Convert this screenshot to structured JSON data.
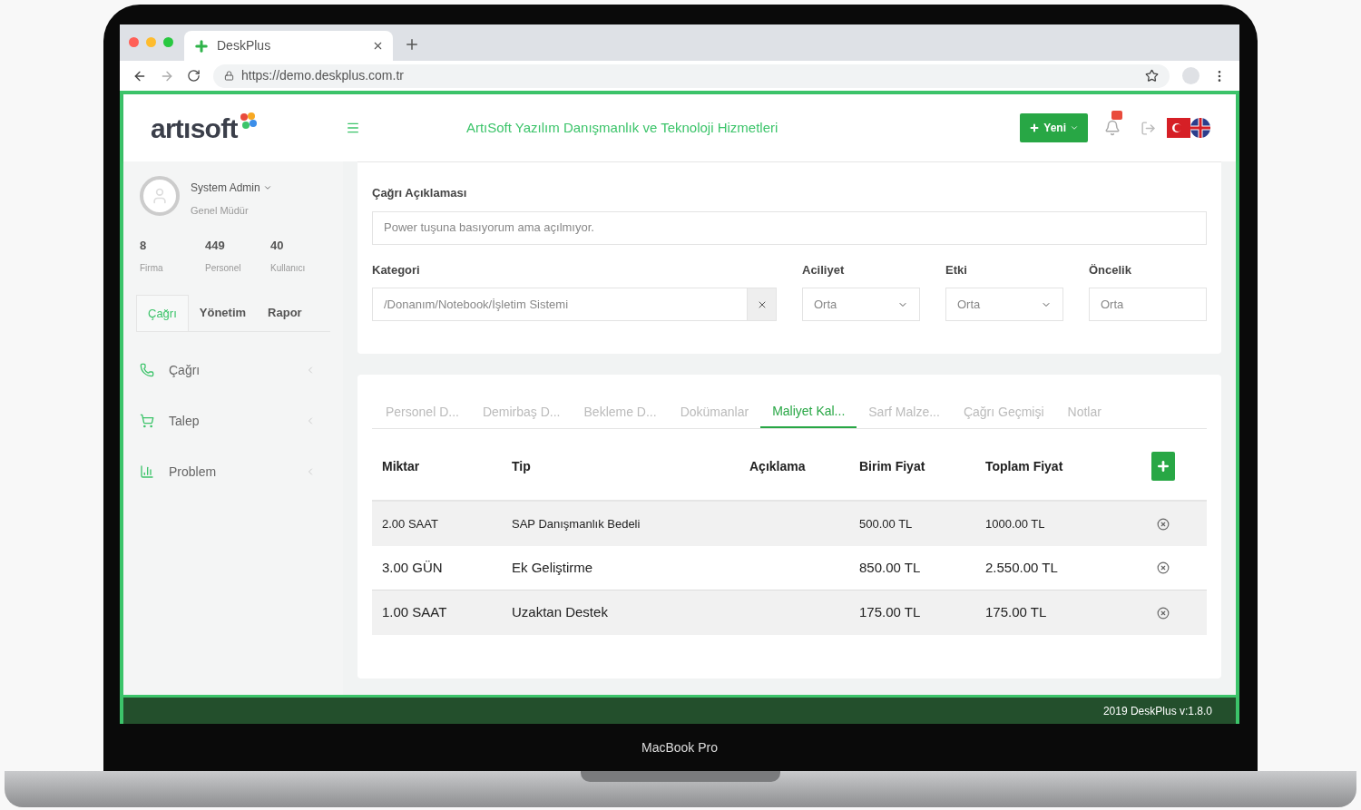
{
  "browser": {
    "tab_title": "DeskPlus",
    "url": "https://demo.deskplus.com.tr"
  },
  "header": {
    "logo": "artısoft",
    "title": "ArtıSoft Yazılım Danışmanlık ve Teknoloji Hizmetleri",
    "new_button": "Yeni"
  },
  "sidebar": {
    "user_name": "System Admin",
    "user_role": "Genel Müdür",
    "stats": [
      {
        "value": "8",
        "label": "Firma"
      },
      {
        "value": "449",
        "label": "Personel"
      },
      {
        "value": "40",
        "label": "Kullanıcı"
      }
    ],
    "tabs": [
      {
        "label": "Çağrı",
        "selected": true
      },
      {
        "label": "Yönetim",
        "selected": false
      },
      {
        "label": "Rapor",
        "selected": false
      }
    ],
    "menu": [
      {
        "label": "Çağrı",
        "kind": "phone"
      },
      {
        "label": "Talep",
        "kind": "cart"
      },
      {
        "label": "Problem",
        "kind": "chart"
      }
    ]
  },
  "form": {
    "description": {
      "label": "Çağrı Açıklaması",
      "value": "Power tuşuna basıyorum ama açılmıyor."
    },
    "fields": [
      {
        "kind": "clearable",
        "label": "Kategori",
        "value": "/Donanım/Notebook/İşletim Sistemi"
      },
      {
        "kind": "select",
        "label": "Aciliyet",
        "value": "Orta"
      },
      {
        "kind": "select",
        "label": "Etki",
        "value": "Orta"
      },
      {
        "kind": "input",
        "label": "Öncelik",
        "value": "Orta"
      }
    ]
  },
  "detail_tabs": [
    {
      "label": "Personel D...",
      "selected": false
    },
    {
      "label": "Demirbaş D...",
      "selected": false
    },
    {
      "label": "Bekleme D...",
      "selected": false
    },
    {
      "label": "Dokümanlar",
      "selected": false
    },
    {
      "label": "Maliyet Kal...",
      "selected": true
    },
    {
      "label": "Sarf Malze...",
      "selected": false
    },
    {
      "label": "Çağrı Geçmişi",
      "selected": false
    },
    {
      "label": "Notlar",
      "selected": false
    }
  ],
  "table": {
    "columns": [
      "Miktar",
      "Tip",
      "Açıklama",
      "Birim Fiyat",
      "Toplam Fiyat"
    ],
    "rows": [
      {
        "cells": [
          "2.00 SAAT",
          "SAP Danışmanlık Bedeli",
          "",
          "500.00 TL",
          "1000.00 TL"
        ]
      },
      {
        "cells": [
          "3.00 GÜN",
          "Ek Geliştirme",
          "",
          "850.00 TL",
          "2.550.00 TL"
        ]
      },
      {
        "cells": [
          "1.00 SAAT",
          "Uzaktan Destek",
          "",
          "175.00 TL",
          "175.00 TL"
        ]
      }
    ]
  },
  "footer": "2019 DeskPlus v:1.8.0",
  "device_label": "MacBook Pro"
}
